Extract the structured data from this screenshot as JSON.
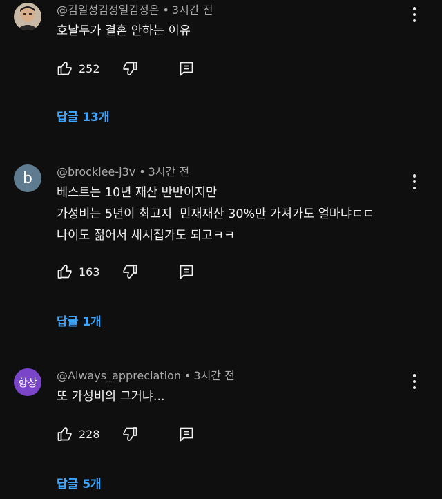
{
  "comments": [
    {
      "author": "@김일성김정일김정은",
      "time": "3시간 전",
      "lines": [
        "호날두가 결혼 안하는 이유"
      ],
      "likes": "252",
      "replies": "답글 13개",
      "avatar": {
        "type": "photo",
        "icon": "user-photo"
      }
    },
    {
      "author": "@brocklee-j3v",
      "time": "3시간 전",
      "lines": [
        "베스트는 10년 재산 반반이지만",
        "가성비는 5년이 최고지  민재재산 30%만 가져가도 얼마냐ㄷㄷ",
        "나이도 젊어서 새시집가도 되고ㅋㅋ"
      ],
      "likes": "163",
      "replies": "답글 1개",
      "avatar": {
        "type": "letter",
        "text": "b",
        "color": "#5f7b90"
      }
    },
    {
      "author": "@Always_appreciation",
      "time": "3시간 전",
      "lines": [
        "또 가성비의 그거냐..."
      ],
      "likes": "228",
      "replies": "답글 5개",
      "avatar": {
        "type": "letter",
        "text": "항상",
        "color": "#7a45c8"
      }
    }
  ],
  "separator": "•",
  "colors": {
    "background": "#0f0f0f",
    "text": "#f1f1f1",
    "meta": "#aaaaaa",
    "link": "#3ea6ff"
  }
}
